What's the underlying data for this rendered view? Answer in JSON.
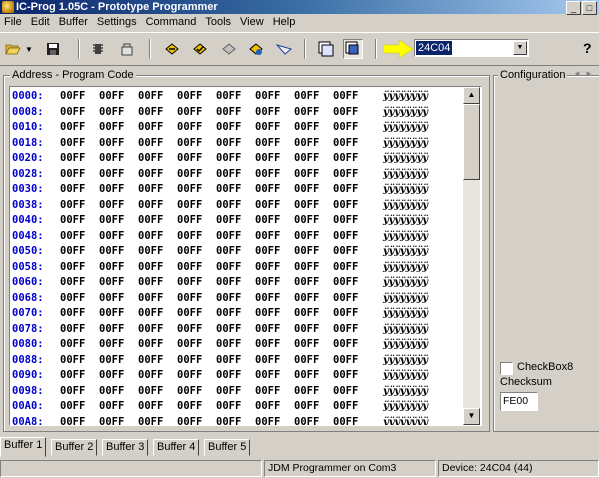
{
  "window": {
    "title": "IC-Prog 1.05C - Prototype Programmer"
  },
  "menu": [
    "File",
    "Edit",
    "Buffer",
    "Settings",
    "Command",
    "Tools",
    "View",
    "Help"
  ],
  "toolbar": {
    "device": "24C04"
  },
  "program_group": {
    "label": "Address - Program Code"
  },
  "code": {
    "rows": [
      {
        "addr": "0000:",
        "cells": [
          "00FF",
          "00FF",
          "00FF",
          "00FF",
          "00FF",
          "00FF",
          "00FF",
          "00FF"
        ],
        "ascii": "ÿÿÿÿÿÿÿÿ"
      },
      {
        "addr": "0008:",
        "cells": [
          "00FF",
          "00FF",
          "00FF",
          "00FF",
          "00FF",
          "00FF",
          "00FF",
          "00FF"
        ],
        "ascii": "ÿÿÿÿÿÿÿÿ"
      },
      {
        "addr": "0010:",
        "cells": [
          "00FF",
          "00FF",
          "00FF",
          "00FF",
          "00FF",
          "00FF",
          "00FF",
          "00FF"
        ],
        "ascii": "ÿÿÿÿÿÿÿÿ"
      },
      {
        "addr": "0018:",
        "cells": [
          "00FF",
          "00FF",
          "00FF",
          "00FF",
          "00FF",
          "00FF",
          "00FF",
          "00FF"
        ],
        "ascii": "ÿÿÿÿÿÿÿÿ"
      },
      {
        "addr": "0020:",
        "cells": [
          "00FF",
          "00FF",
          "00FF",
          "00FF",
          "00FF",
          "00FF",
          "00FF",
          "00FF"
        ],
        "ascii": "ÿÿÿÿÿÿÿÿ"
      },
      {
        "addr": "0028:",
        "cells": [
          "00FF",
          "00FF",
          "00FF",
          "00FF",
          "00FF",
          "00FF",
          "00FF",
          "00FF"
        ],
        "ascii": "ÿÿÿÿÿÿÿÿ"
      },
      {
        "addr": "0030:",
        "cells": [
          "00FF",
          "00FF",
          "00FF",
          "00FF",
          "00FF",
          "00FF",
          "00FF",
          "00FF"
        ],
        "ascii": "ÿÿÿÿÿÿÿÿ"
      },
      {
        "addr": "0038:",
        "cells": [
          "00FF",
          "00FF",
          "00FF",
          "00FF",
          "00FF",
          "00FF",
          "00FF",
          "00FF"
        ],
        "ascii": "ÿÿÿÿÿÿÿÿ"
      },
      {
        "addr": "0040:",
        "cells": [
          "00FF",
          "00FF",
          "00FF",
          "00FF",
          "00FF",
          "00FF",
          "00FF",
          "00FF"
        ],
        "ascii": "ÿÿÿÿÿÿÿÿ"
      },
      {
        "addr": "0048:",
        "cells": [
          "00FF",
          "00FF",
          "00FF",
          "00FF",
          "00FF",
          "00FF",
          "00FF",
          "00FF"
        ],
        "ascii": "ÿÿÿÿÿÿÿÿ"
      },
      {
        "addr": "0050:",
        "cells": [
          "00FF",
          "00FF",
          "00FF",
          "00FF",
          "00FF",
          "00FF",
          "00FF",
          "00FF"
        ],
        "ascii": "ÿÿÿÿÿÿÿÿ"
      },
      {
        "addr": "0058:",
        "cells": [
          "00FF",
          "00FF",
          "00FF",
          "00FF",
          "00FF",
          "00FF",
          "00FF",
          "00FF"
        ],
        "ascii": "ÿÿÿÿÿÿÿÿ"
      },
      {
        "addr": "0060:",
        "cells": [
          "00FF",
          "00FF",
          "00FF",
          "00FF",
          "00FF",
          "00FF",
          "00FF",
          "00FF"
        ],
        "ascii": "ÿÿÿÿÿÿÿÿ"
      },
      {
        "addr": "0068:",
        "cells": [
          "00FF",
          "00FF",
          "00FF",
          "00FF",
          "00FF",
          "00FF",
          "00FF",
          "00FF"
        ],
        "ascii": "ÿÿÿÿÿÿÿÿ"
      },
      {
        "addr": "0070:",
        "cells": [
          "00FF",
          "00FF",
          "00FF",
          "00FF",
          "00FF",
          "00FF",
          "00FF",
          "00FF"
        ],
        "ascii": "ÿÿÿÿÿÿÿÿ"
      },
      {
        "addr": "0078:",
        "cells": [
          "00FF",
          "00FF",
          "00FF",
          "00FF",
          "00FF",
          "00FF",
          "00FF",
          "00FF"
        ],
        "ascii": "ÿÿÿÿÿÿÿÿ"
      },
      {
        "addr": "0080:",
        "cells": [
          "00FF",
          "00FF",
          "00FF",
          "00FF",
          "00FF",
          "00FF",
          "00FF",
          "00FF"
        ],
        "ascii": "ÿÿÿÿÿÿÿÿ"
      },
      {
        "addr": "0088:",
        "cells": [
          "00FF",
          "00FF",
          "00FF",
          "00FF",
          "00FF",
          "00FF",
          "00FF",
          "00FF"
        ],
        "ascii": "ÿÿÿÿÿÿÿÿ"
      },
      {
        "addr": "0090:",
        "cells": [
          "00FF",
          "00FF",
          "00FF",
          "00FF",
          "00FF",
          "00FF",
          "00FF",
          "00FF"
        ],
        "ascii": "ÿÿÿÿÿÿÿÿ"
      },
      {
        "addr": "0098:",
        "cells": [
          "00FF",
          "00FF",
          "00FF",
          "00FF",
          "00FF",
          "00FF",
          "00FF",
          "00FF"
        ],
        "ascii": "ÿÿÿÿÿÿÿÿ"
      },
      {
        "addr": "00A0:",
        "cells": [
          "00FF",
          "00FF",
          "00FF",
          "00FF",
          "00FF",
          "00FF",
          "00FF",
          "00FF"
        ],
        "ascii": "ÿÿÿÿÿÿÿÿ"
      },
      {
        "addr": "00A8:",
        "cells": [
          "00FF",
          "00FF",
          "00FF",
          "00FF",
          "00FF",
          "00FF",
          "00FF",
          "00FF"
        ],
        "ascii": "ÿÿÿÿÿÿÿÿ"
      }
    ]
  },
  "config": {
    "label": "Configuration",
    "checkbox_label": "CheckBox8",
    "checksum_label": "Checksum",
    "checksum_value": "FE00"
  },
  "tabs": [
    "Buffer 1",
    "Buffer 2",
    "Buffer 3",
    "Buffer 4",
    "Buffer 5"
  ],
  "status": {
    "programmer": "JDM Programmer on Com3",
    "device": "Device: 24C04  (44)"
  },
  "icons": {
    "open": "open-folder-icon",
    "save": "save-icon",
    "read": "read-chip-icon",
    "program": "program-chip-icon",
    "erase": "erase-chip-icon",
    "verify": "verify-icon",
    "blank": "blank-check-icon",
    "view1": "view-icon",
    "view2": "view-alt-icon",
    "config": "config-icon",
    "help": "help-icon"
  },
  "colors": {
    "address": "#0000cc",
    "title_start": "#0a246a",
    "selection": "#0a246a"
  }
}
